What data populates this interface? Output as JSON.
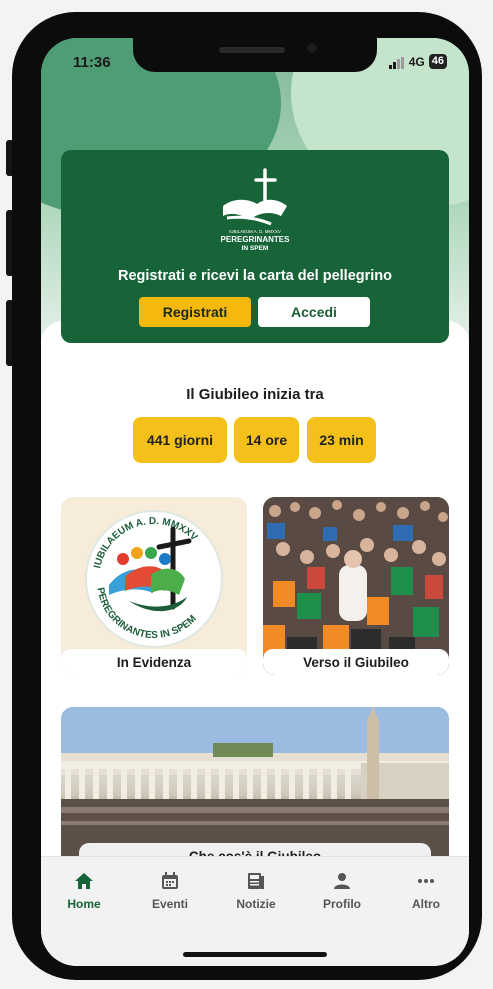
{
  "status_bar": {
    "time": "11:36",
    "network": "4G",
    "battery": "46"
  },
  "banner": {
    "logo_lines": [
      "IUBILAEUM A. D. MMXXV",
      "PEREGRINANTES",
      "IN SPEM"
    ],
    "text": "Registrati e ricevi la carta del pellegrino",
    "register_label": "Registrati",
    "login_label": "Accedi"
  },
  "countdown": {
    "title": "Il Giubileo inizia tra",
    "days": "441 giorni",
    "hours": "14 ore",
    "minutes": "23 min"
  },
  "tiles": {
    "highlight": {
      "label": "In Evidenza",
      "arc_top": "IUBILAEUM A. D. MMXXV",
      "arc_bottom": "PEREGRINANTES IN SPEM"
    },
    "towards": {
      "label": "Verso il Giubileo"
    },
    "whatis": {
      "label": "Che cos'è il Giubileo"
    }
  },
  "tabbar": {
    "items": [
      {
        "label": "Home",
        "icon": "home-icon",
        "active": true
      },
      {
        "label": "Eventi",
        "icon": "calendar-icon"
      },
      {
        "label": "Notizie",
        "icon": "news-icon"
      },
      {
        "label": "Profilo",
        "icon": "profile-icon"
      },
      {
        "label": "Altro",
        "icon": "more-icon"
      }
    ]
  },
  "colors": {
    "brand_green": "#176438",
    "accent_yellow": "#f4c019",
    "tab_active": "#176438"
  }
}
